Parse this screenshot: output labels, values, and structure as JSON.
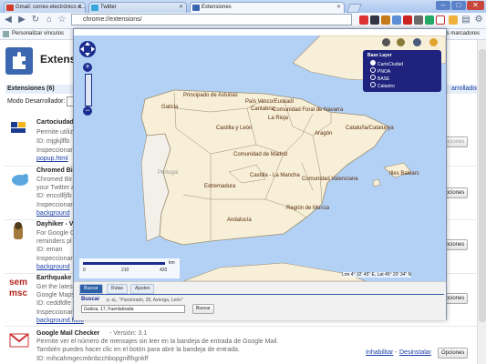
{
  "tabs": [
    {
      "label": "Gmail: correo electrónico d...",
      "icon": "gmail-icon"
    },
    {
      "label": "Twitter",
      "icon": "twitter-icon"
    },
    {
      "label": "Extensiones",
      "icon": "extension-icon"
    }
  ],
  "address_bar": {
    "url": "chrome://extensions/"
  },
  "bookmarks": {
    "left": "Personalizar vínculos",
    "right": "Otros marcadores"
  },
  "page": {
    "title": "Extens",
    "heading": "Extensiones (6)",
    "developer_mode": "Modo Desarrollador:",
    "developer_right": "arrollador"
  },
  "extensions": [
    {
      "name": "Cartociudad",
      "line1": "Permite utiliz",
      "id": "ID: mjgkjlflb",
      "inspect": "Inspeccionar",
      "link": "popup.html",
      "options": "Opciones",
      "icon": "cartociudad-icon"
    },
    {
      "name": "Chromed Bir",
      "line1": "Chromed Bir",
      "line2": "your Twitter a",
      "id": "ID: encollfjfb",
      "inspect": "Inspeccionar",
      "link": "background",
      "options": "Opciones",
      "icon": "bird-icon"
    },
    {
      "name": "Dayhiker - V",
      "line1": "For Google C",
      "line2": "reminders pl",
      "id": "ID: eman",
      "inspect": "Inspeccionar",
      "link": "background",
      "options": "Opciones",
      "icon": "hiker-icon"
    },
    {
      "name": "Earthquake A",
      "line1": "Get the lates",
      "line2": "Google Maps",
      "id": "ID: ceddfdfe",
      "inspect": "Inspeccionar",
      "link": "background.html",
      "options": "Opciones",
      "icon": "earthquake-icon"
    },
    {
      "name": "Google Mail Checker",
      "version": "- Versión: 3.1",
      "line1": "Permite ver el número de mensajes sin leer en la bandeja de entrada de Google Mail.",
      "line2": "También puedes hacer clic en el botón para abrir la bandeja de entrada.",
      "id": "ID: mihcahmgecmbnbcchbopgniflhgnkff",
      "disable": "Inhabilitar",
      "uninstall": "Desinstalar",
      "options": "Opciones",
      "icon": "gmail-checker-icon"
    }
  ],
  "map": {
    "labels": {
      "asturias": "Principado de Asturias",
      "pais_vasco": "País Vasco/Euskadi",
      "cantabria": "Cantabria",
      "navarra": "Comunidad Foral de Navarra",
      "rioja": "La Rioja",
      "galicia": "Galicia",
      "castilla_leon": "Castilla y León",
      "aragon": "Aragón",
      "cataluna": "Cataluña/Catalunya",
      "madrid": "Comunidad de Madrid",
      "castilla_mancha": "Castilla - La Mancha",
      "valencia": "Comunidad Valenciana",
      "extremadura": "Extremadura",
      "baleares": "Illes Balears",
      "murcia": "Región de Murcia",
      "andalucia": "Andalucía",
      "portugal": "Portugal"
    },
    "layers": {
      "title": "Base Layer",
      "options": [
        "CartoCiudad",
        "PNOA",
        "BASE",
        "Catastro"
      ],
      "selected": "CartoCiudad"
    },
    "scale": {
      "ticks": [
        "0",
        "210",
        "420"
      ],
      "unit": "km"
    },
    "coords": "Lon 4° 32' 45\" E, Lat 45° 20' 34\" N"
  },
  "search": {
    "tabs": [
      "Buscar",
      "Rutas",
      "Ajustes"
    ],
    "active_tab": "Buscar",
    "label": "Buscar",
    "hint": "p. ej., \"Pandorado, 28, Astorga, León\"",
    "input_value": "Galicia, 17, Fuenlabrada",
    "button": "Buscar"
  },
  "colors": {
    "land": "#f7efd7",
    "sea": "#b3d1f5",
    "border": "#9b8e70",
    "layerbox": "#1f237e"
  }
}
